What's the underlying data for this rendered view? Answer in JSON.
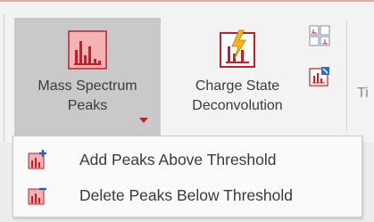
{
  "ribbon": {
    "mass_button": {
      "line1": "Mass Spectrum",
      "line2": "Peaks",
      "icon": "mass-spectrum-peaks-icon"
    },
    "charge_button": {
      "line1": "Charge State",
      "line2": "Deconvolution",
      "icon": "charge-deconvolution-icon"
    },
    "small_icons": [
      "spectrum-grid-icon",
      "spectrum-edit-icon"
    ],
    "cut_label": "Ti"
  },
  "menu": {
    "items": [
      {
        "label": "Add Peaks Above Threshold",
        "icon": "add-peaks-icon"
      },
      {
        "label": "Delete Peaks Below Threshold",
        "icon": "delete-peaks-icon"
      }
    ]
  },
  "colors": {
    "accent_red": "#c0202a",
    "selected_bg": "#c9c9c9",
    "add_blue": "#1e63b8"
  }
}
